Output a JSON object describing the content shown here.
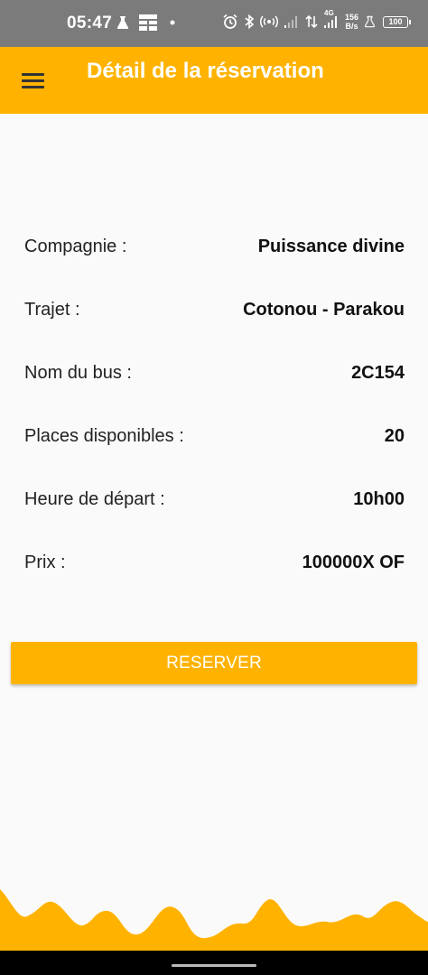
{
  "status_bar": {
    "time": "05:47",
    "network_type": "4G",
    "speed_value": "156",
    "speed_unit": "B/s",
    "battery": "100"
  },
  "app_bar": {
    "title": "Détail de la réservation",
    "menu_icon": "hamburger-menu-icon",
    "color": "#ffb300"
  },
  "details": [
    {
      "label": "Compagnie :",
      "value": "Puissance divine"
    },
    {
      "label": "Trajet :",
      "value": "Cotonou - Parakou"
    },
    {
      "label": "Nom du bus :",
      "value": "2C154"
    },
    {
      "label": "Places disponibles :",
      "value": "20"
    },
    {
      "label": "Heure de départ :",
      "value": "10h00"
    },
    {
      "label": "Prix :",
      "value": "100000X OF"
    }
  ],
  "actions": {
    "reserve_label": "RESERVER"
  }
}
